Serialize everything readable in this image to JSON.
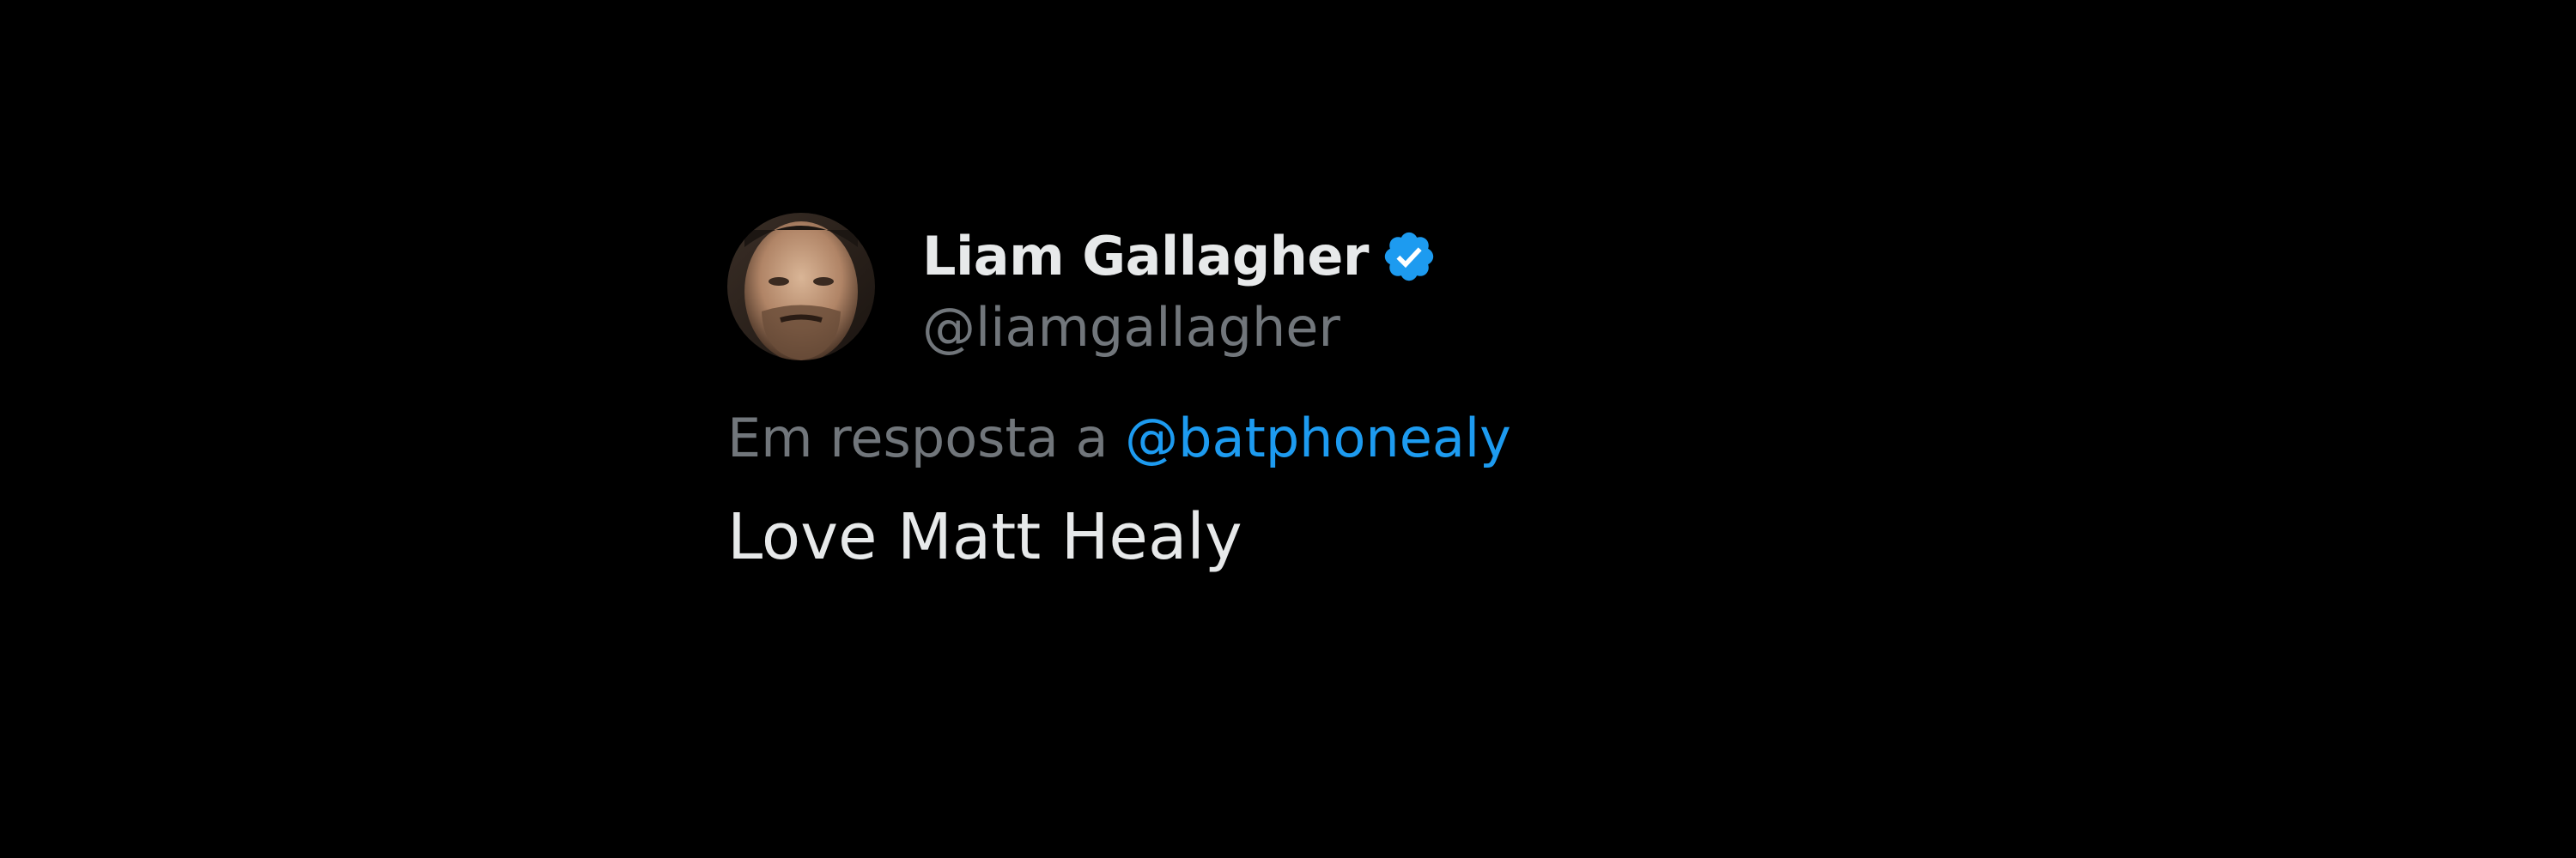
{
  "tweet": {
    "author": {
      "display_name": "Liam Gallagher",
      "handle": "@liamgallagher",
      "verified_icon": "verified-badge-icon"
    },
    "reply": {
      "prefix": "Em resposta a",
      "target": "@batphonealy"
    },
    "text": "Love Matt Healy"
  },
  "colors": {
    "background": "#000000",
    "primary_text": "#e7e9ea",
    "secondary_text": "#71767b",
    "accent": "#1d9bf0"
  }
}
